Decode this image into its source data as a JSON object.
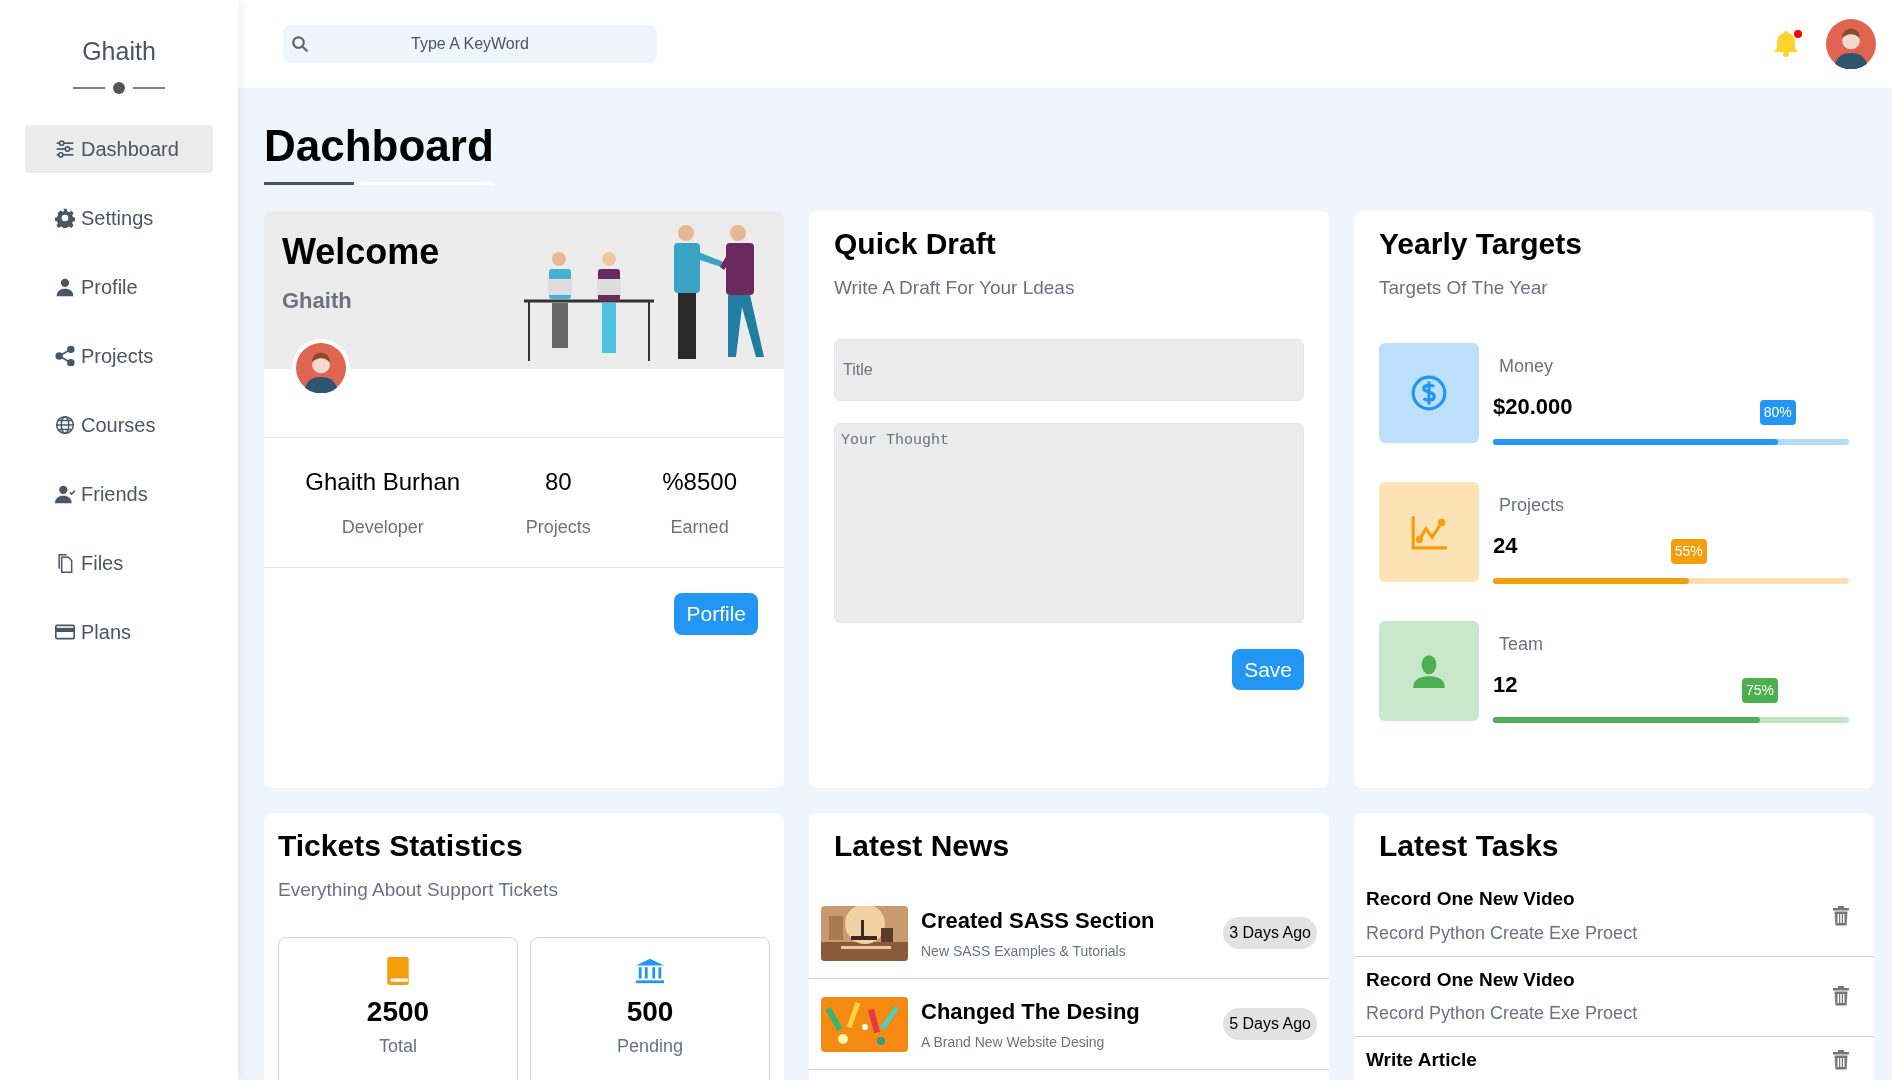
{
  "sidebar": {
    "logo": "Ghaith",
    "items": [
      {
        "label": "Dashboard",
        "selected": true
      },
      {
        "label": "Settings",
        "selected": false
      },
      {
        "label": "Profile",
        "selected": false
      },
      {
        "label": "Projects",
        "selected": false
      },
      {
        "label": "Courses",
        "selected": false
      },
      {
        "label": "Friends",
        "selected": false
      },
      {
        "label": "Files",
        "selected": false
      },
      {
        "label": "Plans",
        "selected": false
      }
    ]
  },
  "header": {
    "search": {
      "placeholder": "Type A KeyWord"
    }
  },
  "page_title": "Dachboard",
  "welcome": {
    "title": "Welcome",
    "name": "Ghaith",
    "stats": [
      {
        "value": "Ghaith Burhan",
        "label": "Developer"
      },
      {
        "value": "80",
        "label": "Projects"
      },
      {
        "value": "%8500",
        "label": "Earned"
      }
    ],
    "button": "Porfile"
  },
  "quick_draft": {
    "title": "Quick Draft",
    "subtitle": "Write A Draft For Your Ldeas",
    "title_placeholder": "Title",
    "body_placeholder": "Your Thought",
    "button": "Save"
  },
  "yearly_targets": {
    "title": "Yearly Targets",
    "subtitle": "Targets Of The Year",
    "items": [
      {
        "label": "Money",
        "value": "$20.000",
        "badge": "80%",
        "level": 0.8,
        "color": "#2196f3"
      },
      {
        "label": "Projects",
        "value": "24",
        "badge": "55%",
        "level": 0.55,
        "color": "#f59e0b"
      },
      {
        "label": "Team",
        "value": "12",
        "badge": "75%",
        "level": 0.75,
        "color": "#4caf50"
      }
    ]
  },
  "tickets": {
    "title": "Tickets Statistics",
    "subtitle": "Everything About Support Tickets",
    "items": [
      {
        "value": "2500",
        "label": "Total",
        "color": "#f59e0b"
      },
      {
        "value": "500",
        "label": "Pending",
        "color": "#2196f3"
      }
    ]
  },
  "news": {
    "title": "Latest News",
    "items": [
      {
        "title": "Created SASS Section",
        "subtitle": "New SASS Examples & Tutorials",
        "date": "3 Days Ago"
      },
      {
        "title": "Changed The Desing",
        "subtitle": "A Brand New Website Desing",
        "date": "5 Days Ago"
      }
    ]
  },
  "tasks": {
    "title": "Latest Tasks",
    "items": [
      {
        "title": "Record One New Video",
        "description": "Record Python Create Exe Proect"
      },
      {
        "title": "Record One New Video",
        "description": "Record Python Create Exe Proect"
      },
      {
        "title": "Write Article"
      }
    ]
  }
}
